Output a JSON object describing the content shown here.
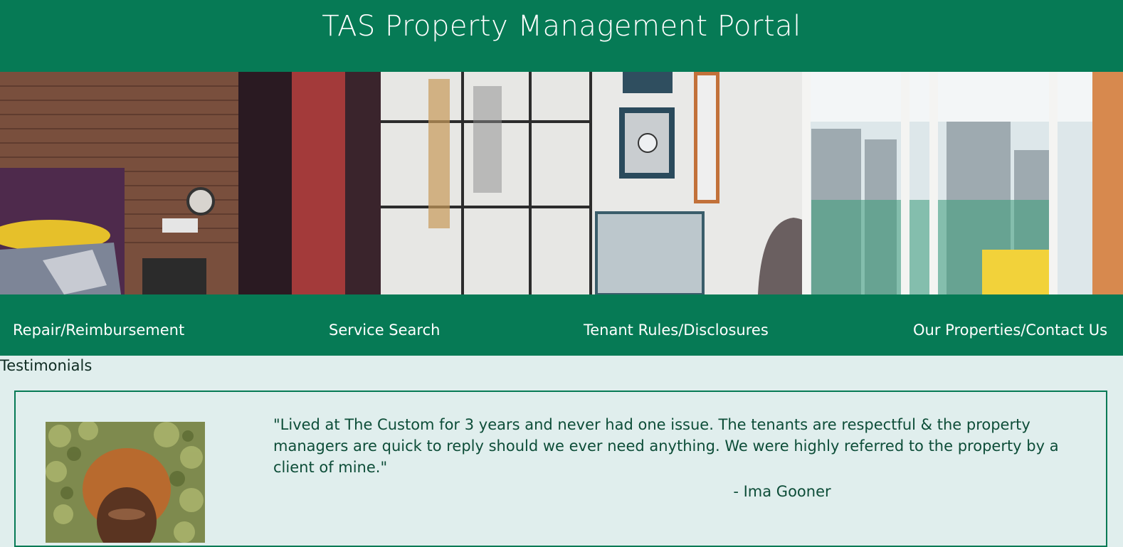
{
  "header": {
    "title": "TAS Property Management Portal"
  },
  "hero": {
    "image_description": "modern apartment interior with brick wall, bed, mirrored doors, wall safe, chair and large window view of buildings"
  },
  "nav": {
    "items": [
      {
        "label": "Repair/Reimbursement"
      },
      {
        "label": "Service Search"
      },
      {
        "label": "Tenant Rules/Disclosures"
      },
      {
        "label": "Our Properties/Contact Us"
      }
    ]
  },
  "testimonials": {
    "heading": "Testimonials",
    "items": [
      {
        "quote": "\"Lived at The Custom for 3 years and never had one issue. The tenants are respectful & the property managers are quick to reply should we ever need anything. We were highly referred to the property by a client of mine.\"",
        "author": "- Ima Gooner"
      }
    ]
  },
  "colors": {
    "brand_green": "#067a55",
    "page_background": "#e0eeed",
    "text_dark_green": "#0d4d38"
  }
}
